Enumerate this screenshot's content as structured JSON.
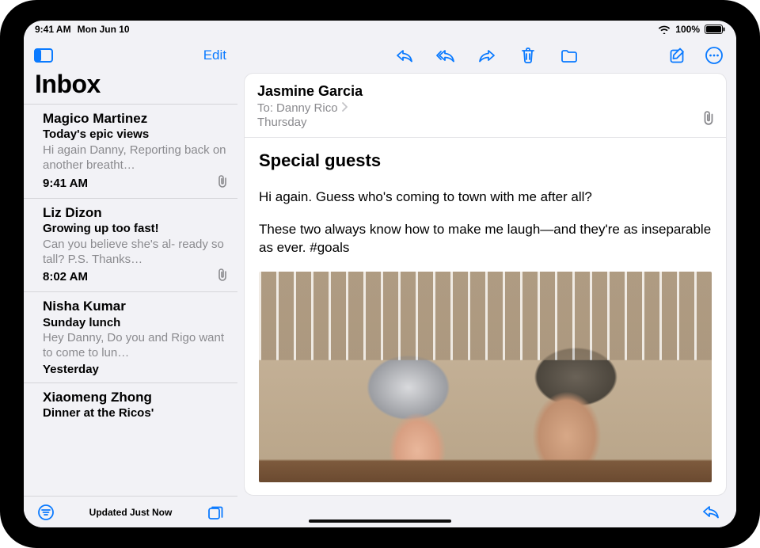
{
  "status": {
    "time": "9:41 AM",
    "date": "Mon Jun 10",
    "battery": "100%"
  },
  "sidebar": {
    "edit": "Edit",
    "title": "Inbox",
    "updated": "Updated Just Now"
  },
  "messages": [
    {
      "sender": "Magico Martinez",
      "subject": "Today's epic views",
      "preview": "Hi again Danny, Reporting back on another breatht…",
      "time": "9:41 AM",
      "attachment": true
    },
    {
      "sender": "Liz Dizon",
      "subject": "Growing up too fast!",
      "preview": "Can you believe she's al- ready so tall? P.S. Thanks…",
      "time": "8:02 AM",
      "attachment": true
    },
    {
      "sender": "Nisha Kumar",
      "subject": "Sunday lunch",
      "preview": "Hey Danny, Do you and Rigo want to come to lun…",
      "time": "Yesterday",
      "attachment": false
    },
    {
      "sender": "Xiaomeng Zhong",
      "subject": "Dinner at the Ricos'",
      "preview": "",
      "time": "",
      "attachment": false
    }
  ],
  "reader": {
    "from": "Jasmine Garcia",
    "to_label": "To:",
    "to_name": "Danny Rico",
    "date": "Thursday",
    "subject": "Special guests",
    "paragraphs": [
      "Hi again. Guess who's coming to town with me after all?",
      "These two always know how to make me laugh—and they're as inseparable as ever. #goals"
    ]
  }
}
